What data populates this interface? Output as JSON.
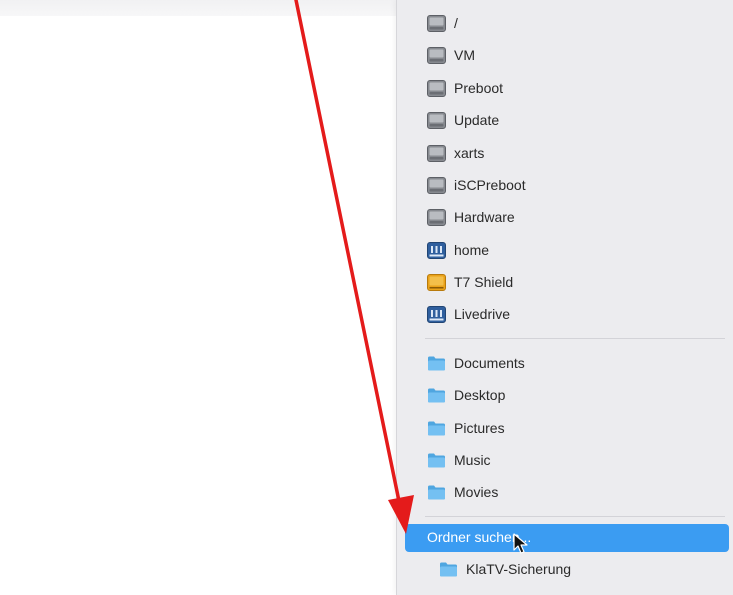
{
  "locations": {
    "volumes": [
      {
        "label": "/",
        "icon": "disk-icon"
      },
      {
        "label": "VM",
        "icon": "disk-icon"
      },
      {
        "label": "Preboot",
        "icon": "disk-icon"
      },
      {
        "label": "Update",
        "icon": "disk-icon"
      },
      {
        "label": "xarts",
        "icon": "disk-icon"
      },
      {
        "label": "iSCPreboot",
        "icon": "disk-icon"
      },
      {
        "label": "Hardware",
        "icon": "disk-icon"
      },
      {
        "label": "home",
        "icon": "network-drive-icon"
      },
      {
        "label": "T7 Shield",
        "icon": "external-drive-icon"
      },
      {
        "label": "Livedrive",
        "icon": "network-drive-icon"
      }
    ],
    "folders": [
      {
        "label": "Documents",
        "icon": "folder-icon"
      },
      {
        "label": "Desktop",
        "icon": "folder-icon"
      },
      {
        "label": "Pictures",
        "icon": "folder-icon"
      },
      {
        "label": "Music",
        "icon": "folder-icon"
      },
      {
        "label": "Movies",
        "icon": "folder-icon"
      }
    ]
  },
  "search_folder": {
    "label": "Ordner suchen..."
  },
  "recent": {
    "label": "KlaTV-Sicherung",
    "icon": "folder-icon"
  },
  "colors": {
    "menu_bg": "#ececef",
    "highlight": "#3b9cf2",
    "arrow": "#e41b1b",
    "folder": "#5fb4ea",
    "external_drive": "#e9a21a"
  }
}
